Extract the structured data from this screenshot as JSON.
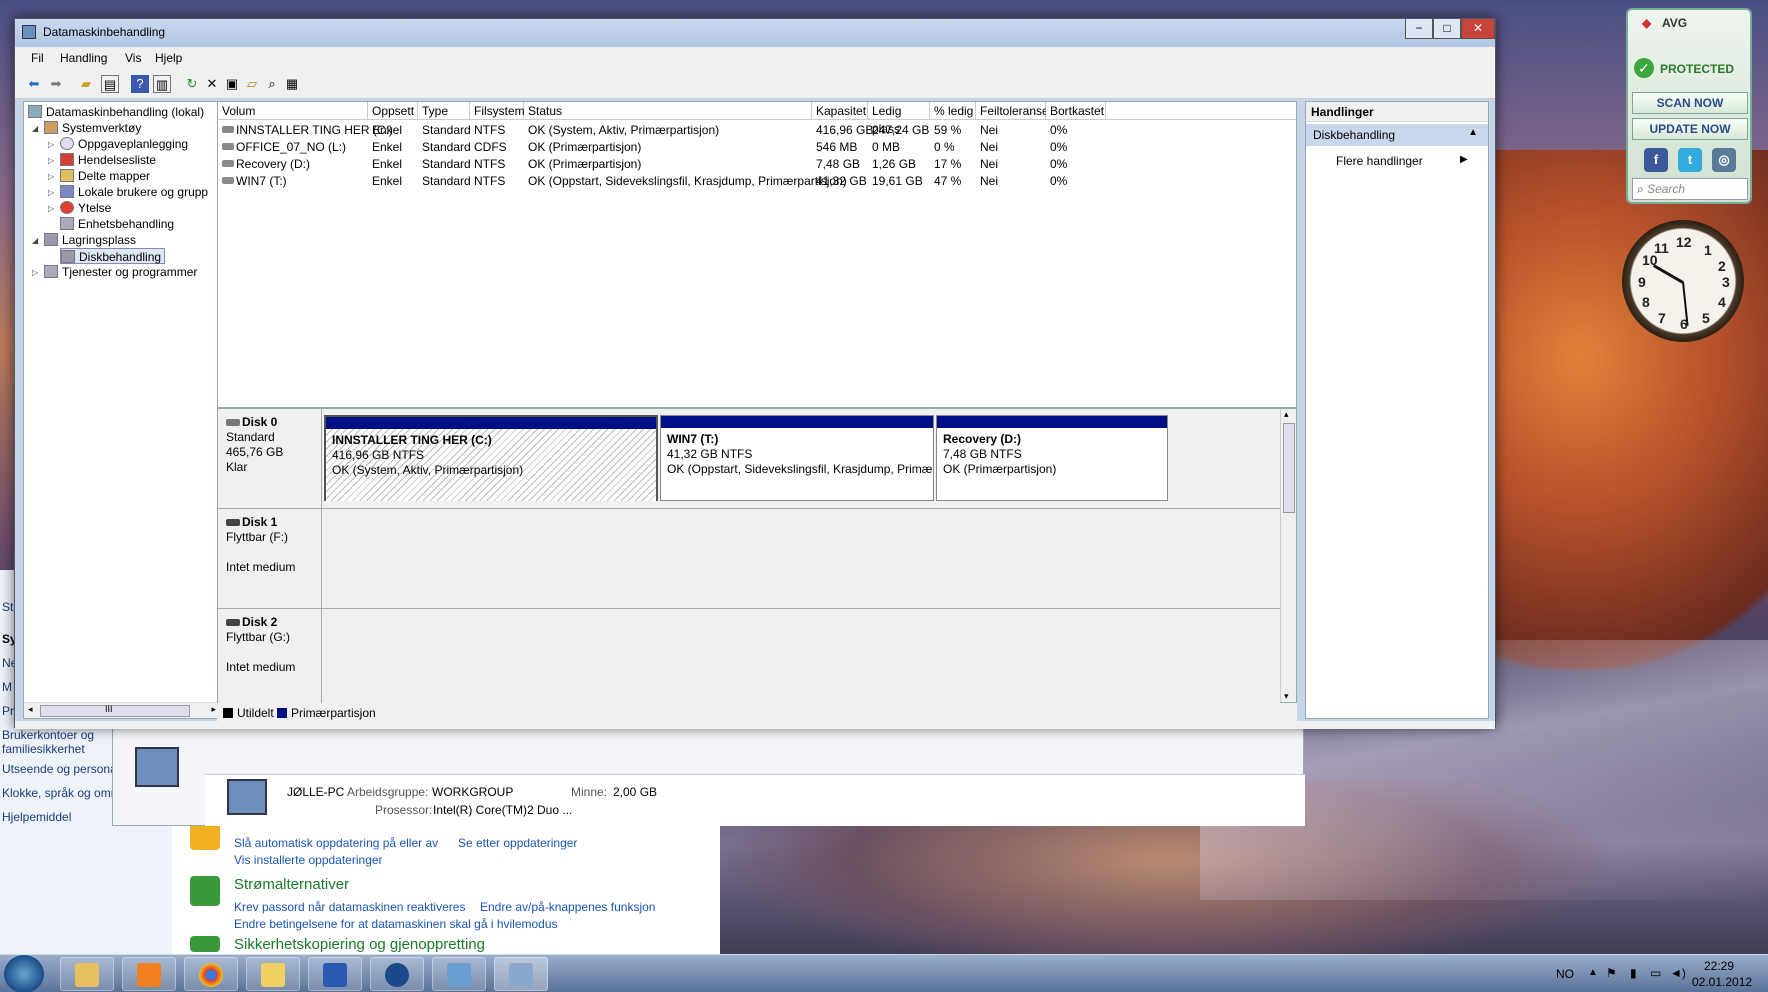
{
  "window": {
    "title": "Datamaskinbehandling",
    "controls": {
      "minimize": "−",
      "maximize": "□",
      "close": "✕"
    }
  },
  "menu": [
    "Fil",
    "Handling",
    "Vis",
    "Hjelp"
  ],
  "toolbar_icons": [
    "back-arrow-icon",
    "forward-arrow-icon",
    "up-folder-icon",
    "show-hide-tree-icon",
    "help-icon",
    "show-hide-action-icon",
    "refresh-icon",
    "delete-icon",
    "properties-icon",
    "open-icon",
    "search-icon",
    "export-icon"
  ],
  "tree": {
    "root": "Datamaskinbehandling (lokal)",
    "items": [
      {
        "label": "Systemverktøy",
        "level": 1,
        "expander": "◢"
      },
      {
        "label": "Oppgaveplanlegging",
        "level": 2,
        "expander": "▷"
      },
      {
        "label": "Hendelsesliste",
        "level": 2,
        "expander": "▷"
      },
      {
        "label": "Delte mapper",
        "level": 2,
        "expander": "▷"
      },
      {
        "label": "Lokale brukere og grupp",
        "level": 2,
        "expander": "▷"
      },
      {
        "label": "Ytelse",
        "level": 2,
        "expander": "▷"
      },
      {
        "label": "Enhetsbehandling",
        "level": 2,
        "expander": ""
      },
      {
        "label": "Lagringsplass",
        "level": 1,
        "expander": "◢"
      },
      {
        "label": "Diskbehandling",
        "level": 2,
        "expander": "",
        "selected": true
      },
      {
        "label": "Tjenester og programmer",
        "level": 1,
        "expander": "▷"
      }
    ],
    "scroll_grip": "III"
  },
  "volume_table": {
    "columns": [
      "Volum",
      "Oppsett",
      "Type",
      "Filsystem",
      "Status",
      "Kapasitet",
      "Ledig plass",
      "% ledig",
      "Feiltoleranse",
      "Bortkastet"
    ],
    "rows": [
      [
        "INNSTALLER TING HER (C:)",
        "Enkel",
        "Standard",
        "NTFS",
        "OK (System, Aktiv, Primærpartisjon)",
        "416,96 GB",
        "247,24 GB",
        "59 %",
        "Nei",
        "0%"
      ],
      [
        "OFFICE_07_NO (L:)",
        "Enkel",
        "Standard",
        "CDFS",
        "OK (Primærpartisjon)",
        "546 MB",
        "0 MB",
        "0 %",
        "Nei",
        "0%"
      ],
      [
        "Recovery (D:)",
        "Enkel",
        "Standard",
        "NTFS",
        "OK (Primærpartisjon)",
        "7,48 GB",
        "1,26 GB",
        "17 %",
        "Nei",
        "0%"
      ],
      [
        "WIN7 (T:)",
        "Enkel",
        "Standard",
        "NTFS",
        "OK (Oppstart, Sidevekslingsfil, Krasjdump, Primærpartisjon)",
        "41,32 GB",
        "19,61 GB",
        "47 %",
        "Nei",
        "0%"
      ]
    ]
  },
  "disks": [
    {
      "name": "Disk 0",
      "line1": "Standard",
      "line2": "465,76 GB",
      "line3": "Klar",
      "partitions": [
        {
          "name": "INNSTALLER TING HER  (C:)",
          "size": "416,96 GB NTFS",
          "status": "OK (System, Aktiv, Primærpartisjon)"
        },
        {
          "name": "WIN7  (T:)",
          "size": "41,32 GB NTFS",
          "status": "OK (Oppstart, Sidevekslingsfil, Krasjdump, Primærpartisj"
        },
        {
          "name": "Recovery  (D:)",
          "size": "7,48 GB NTFS",
          "status": "OK (Primærpartisjon)"
        }
      ]
    },
    {
      "name": "Disk 1",
      "line1": "Flyttbar (F:)",
      "line2": "",
      "line3": "Intet medium"
    },
    {
      "name": "Disk 2",
      "line1": "Flyttbar (G:)",
      "line2": "",
      "line3": "Intet medium"
    }
  ],
  "legend": [
    {
      "label": "Utildelt",
      "color": "#000000"
    },
    {
      "label": "Primærpartisjon",
      "color": "#000f86"
    }
  ],
  "actions": {
    "header": "Handlinger",
    "section": "Diskbehandling",
    "more": "Flere handlinger"
  },
  "avg": {
    "brand": "AVG",
    "status": "PROTECTED",
    "scan": "SCAN NOW",
    "update": "UPDATE NOW",
    "search_placeholder": "Search",
    "social": [
      "f",
      "t",
      "◎"
    ]
  },
  "clock": {
    "numbers": [
      "12",
      "1",
      "2",
      "3",
      "4",
      "5",
      "6",
      "7",
      "8",
      "9",
      "10",
      "11"
    ]
  },
  "control_panel": {
    "sidebar": [
      "St",
      "Sy",
      "Ne",
      "M",
      "Pr",
      "Brukerkontoer og",
      "familiesikkerhet",
      "Utseende og persona",
      "Klokke, språk og omr",
      "Hjelpemiddel"
    ],
    "system": {
      "pc_name": "JØLLE-PC",
      "workgroup_label": "Arbeidsgruppe:",
      "workgroup": "WORKGROUP",
      "memory_label": "Minne:",
      "memory": "2,00 GB",
      "processor_label": "Prosessor:",
      "processor": "Intel(R) Core(TM)2 Duo ..."
    },
    "update_links": [
      "Slå automatisk oppdatering på eller av",
      "Se etter oppdateringer",
      "Vis installerte oppdateringer"
    ],
    "power_heading": "Strømalternativer",
    "power_links": [
      "Krev passord når datamaskinen reaktiveres",
      "Endre av/på-knappenes funksjon",
      "Endre betingelsene for at datamaskinen skal gå i hvilemodus"
    ],
    "backup_heading": "Sikkerhetskopiering og gjenoppretting"
  },
  "taskbar": {
    "apps": [
      "explorer",
      "media-player",
      "chrome",
      "live-messenger",
      "word",
      "hp",
      "control-panel",
      "computer-management"
    ],
    "lang": "NO",
    "time": "22:29",
    "date": "02.01.2012"
  },
  "colors": {
    "primary_partition": "#000f86",
    "selected_action": "#c9d7ec",
    "avg_green": "#2a7a2a"
  }
}
